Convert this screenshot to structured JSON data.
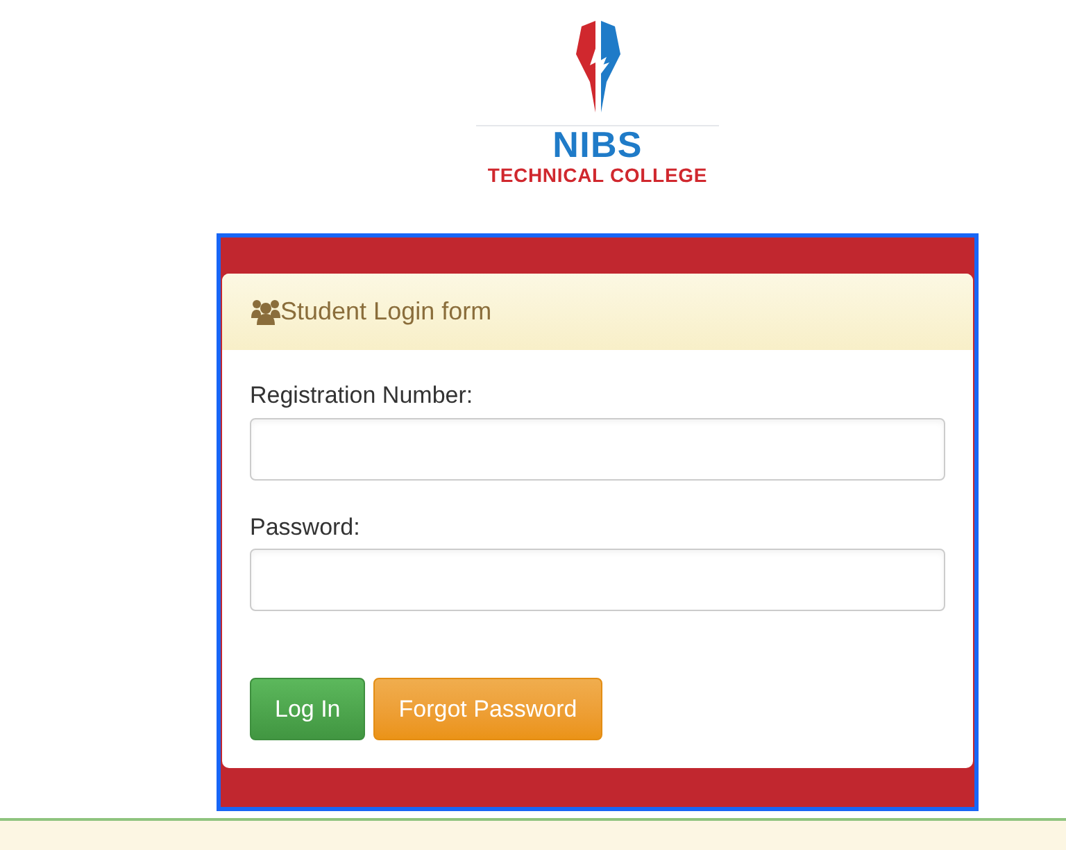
{
  "logo": {
    "name": "NIBS",
    "subtitle": "TECHNICAL COLLEGE"
  },
  "panel": {
    "title": "Student Login form"
  },
  "fields": [
    {
      "label": "Registration Number:"
    },
    {
      "label": "Password:"
    }
  ],
  "buttons": [
    {
      "label": "Log In",
      "kind": "primary"
    },
    {
      "label": "Forgot Password",
      "kind": "warning"
    }
  ]
}
